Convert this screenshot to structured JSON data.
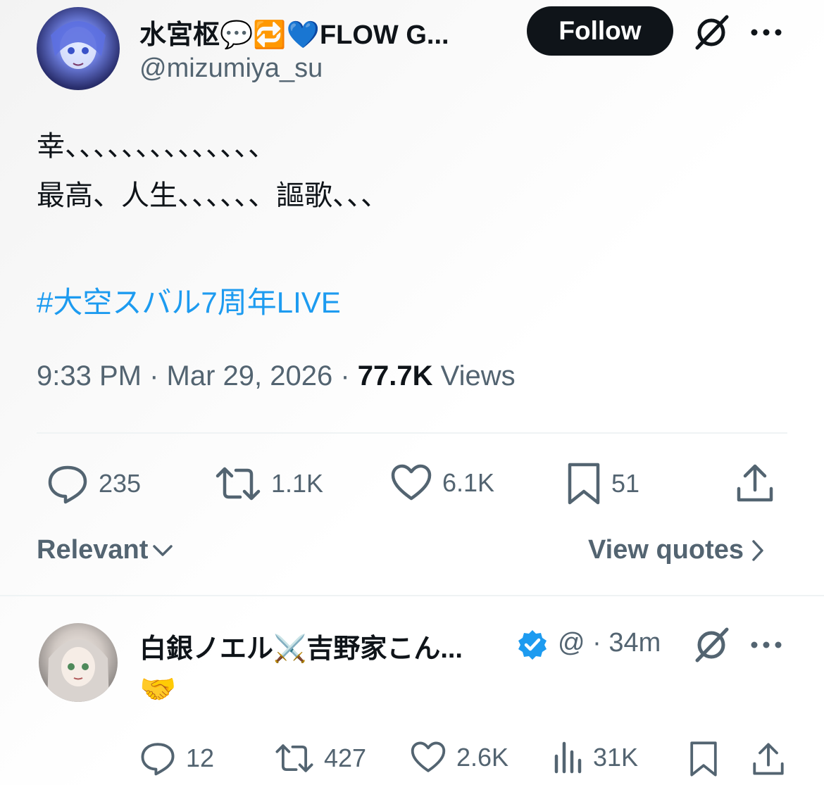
{
  "tweet": {
    "display_name": "水宮枢💬🔁💙FLOW G...",
    "handle": "@mizumiya_su",
    "follow_label": "Follow",
    "lines": [
      "幸、、、、、、、、、、、、、、",
      "最高、人生、、、、、、謳歌、、、"
    ],
    "hashtag": "#大空スバル7周年LIVE",
    "time": "9:33 PM · Mar 29, 2026 · ",
    "views_count": "77.7K",
    "views_label": " Views",
    "stats": {
      "replies": "235",
      "reposts": "1.1K",
      "likes": "6.1K",
      "bookmarks": "51"
    }
  },
  "sort": {
    "label": "Relevant"
  },
  "quotes": {
    "label": "View quotes"
  },
  "reply": {
    "display_name": "白銀ノエル⚔️吉野家こん...",
    "handle_time": "@ · 34m",
    "text": "🤝",
    "stats": {
      "replies": "12",
      "reposts": "427",
      "likes": "2.6K",
      "views": "31K"
    }
  },
  "colors": {
    "accent": "#1d9bf0",
    "text": "#0f1419",
    "secondary": "#536471",
    "verified": "#1d9bf0"
  }
}
